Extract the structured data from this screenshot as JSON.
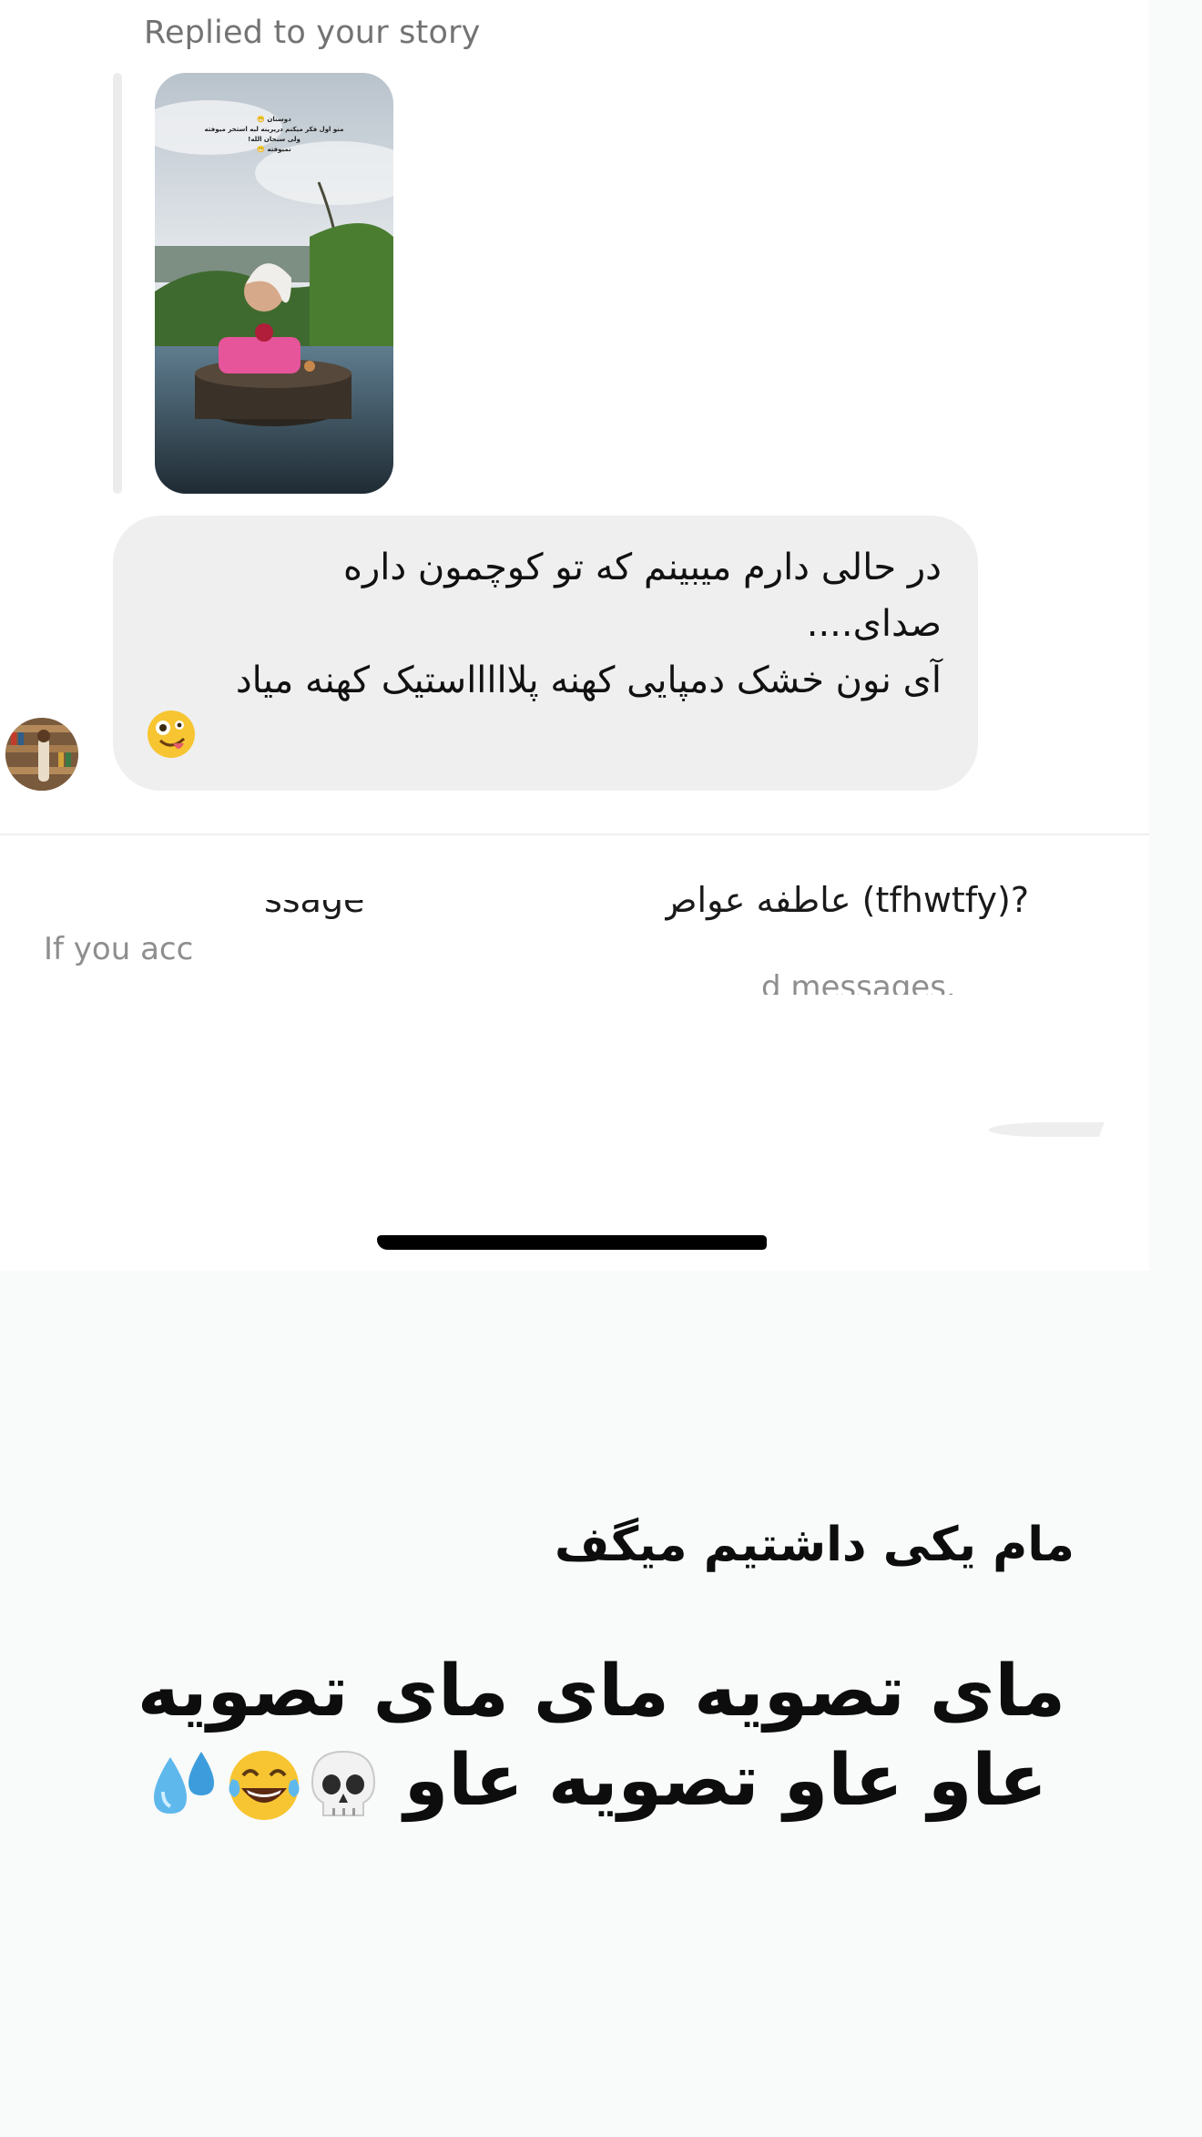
{
  "chat": {
    "replied_label": "Replied to your story",
    "story_caption": "دوستان 😬\nمنو اول فکر میکنم دریرینه لبه استخر میوفته\nولی سبحان الله!\nنمیوفته 😬",
    "message_lines": [
      "در حالی دارم میبینم که تو کوچمون داره",
      "صدای....",
      "آی نون خشک دمپایی کهنه پلاااااستیک کهنه میاد"
    ],
    "message_emoji": "zany-face-emoji"
  },
  "request": {
    "title_left": "ssage",
    "title_right": "عاطفه عواص (tfhwtfy)?",
    "body_left": "If you acc",
    "body_right": "d messages."
  },
  "overlay": {
    "line1": "مام یکی داشتیم میگف",
    "line2": "مای تصویه مای مای تصویه",
    "line3": "عاو عاو تصویه عاو",
    "emojis": [
      "skull-emoji",
      "tears-of-joy-emoji",
      "sweat-droplets-emoji"
    ]
  },
  "colors": {
    "bubble": "#efeff0",
    "overlay_bg": "#f9fafa",
    "muted_text": "#737373"
  }
}
